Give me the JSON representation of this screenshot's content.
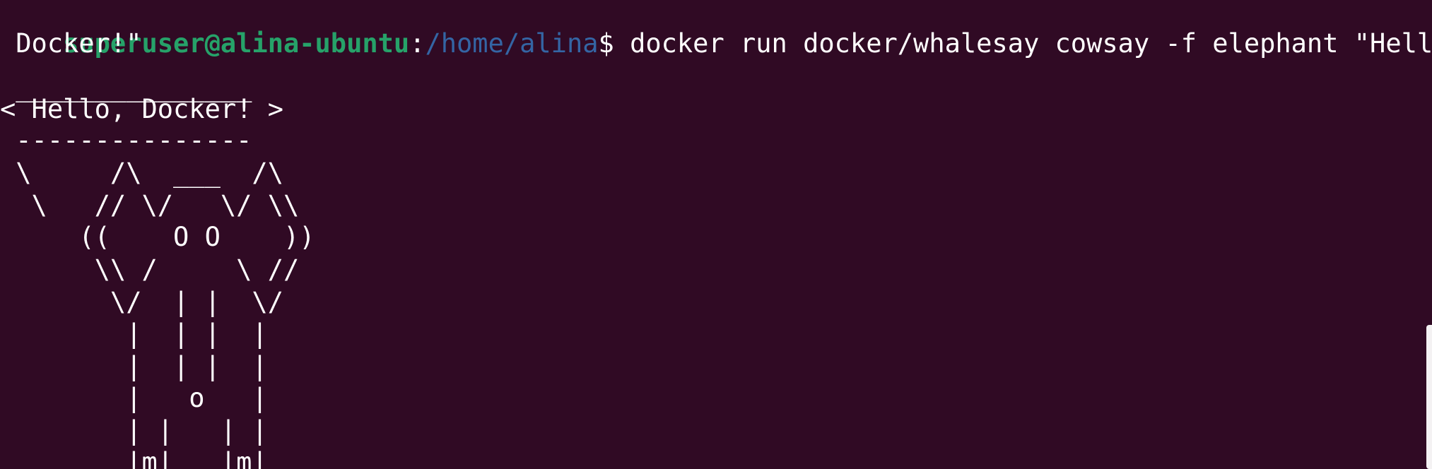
{
  "terminal": {
    "prompt": {
      "user_host": "superuser@alina-ubuntu",
      "separator": ":",
      "path": "/home/alina",
      "dollar": "$",
      "command": " docker run docker/whalesay cowsay -f elephant \"Hello,"
    },
    "command_wrap": " Docker!\"",
    "output_lines": [
      " _______________",
      "< Hello, Docker! >",
      " ---------------",
      " \\     /\\  ___  /\\",
      "  \\   // \\/   \\/ \\\\",
      "     ((    O O    ))",
      "      \\\\ /     \\ //",
      "       \\/  | |  \\/",
      "        |  | |  |",
      "        |  | |  |",
      "        |   o   |",
      "        | |   | |",
      "        |m|   |m|"
    ]
  },
  "colors": {
    "background": "#300a24",
    "user_host": "#26a269",
    "path": "#3465a4",
    "text": "#ffffff"
  }
}
